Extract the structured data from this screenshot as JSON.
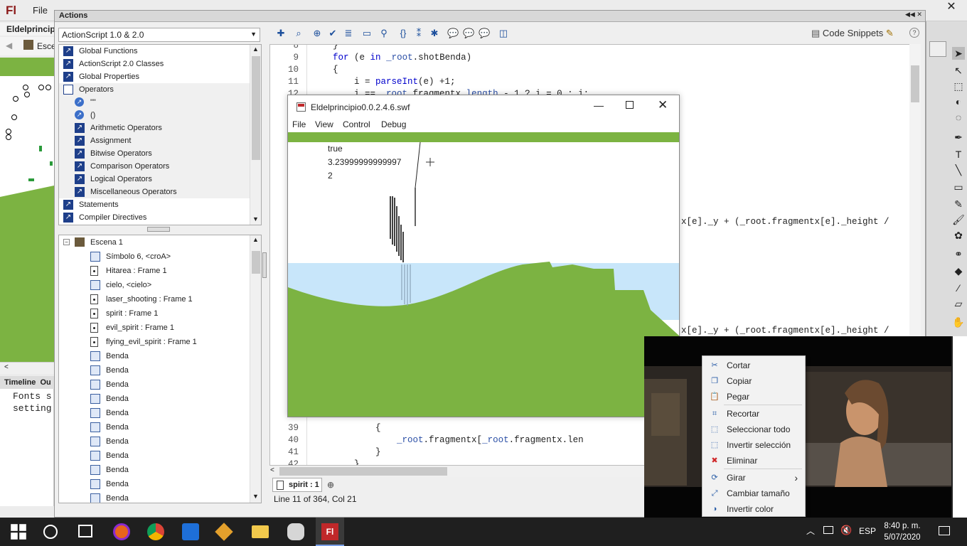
{
  "app": {
    "logo": "Fl",
    "menu_file": "File",
    "doc_tab": "Eldelprincipi",
    "breadcrumb": "Esce"
  },
  "actions": {
    "title": "Actions",
    "version": "ActionScript 1.0 & 2.0",
    "toolbox": [
      {
        "label": "Global Functions",
        "indent": 0
      },
      {
        "label": "ActionScript 2.0 Classes",
        "indent": 0
      },
      {
        "label": "Global Properties",
        "indent": 0
      },
      {
        "label": "Operators",
        "indent": 0,
        "open": true
      },
      {
        "label": "\"\"",
        "indent": 1,
        "bullet": true
      },
      {
        "label": "()",
        "indent": 1,
        "bullet": true
      },
      {
        "label": "Arithmetic Operators",
        "indent": 1
      },
      {
        "label": "Assignment",
        "indent": 1
      },
      {
        "label": "Bitwise Operators",
        "indent": 1
      },
      {
        "label": "Comparison Operators",
        "indent": 1
      },
      {
        "label": "Logical Operators",
        "indent": 1
      },
      {
        "label": "Miscellaneous Operators",
        "indent": 1
      },
      {
        "label": "Statements",
        "indent": 0
      },
      {
        "label": "Compiler Directives",
        "indent": 0
      }
    ],
    "scene": "Escena 1",
    "tree": [
      {
        "label": "Símbolo 6, <croA>",
        "kind": "sym"
      },
      {
        "label": "Hitarea : Frame 1",
        "kind": "frame"
      },
      {
        "label": "cielo, <cielo>",
        "kind": "sym"
      },
      {
        "label": "laser_shooting : Frame 1",
        "kind": "frame"
      },
      {
        "label": "spirit : Frame 1",
        "kind": "frame"
      },
      {
        "label": "evil_spirit : Frame 1",
        "kind": "frame"
      },
      {
        "label": "flying_evil_spirit : Frame 1",
        "kind": "frame"
      },
      {
        "label": "Benda",
        "kind": "sym"
      },
      {
        "label": "Benda",
        "kind": "sym"
      },
      {
        "label": "Benda",
        "kind": "sym"
      },
      {
        "label": "Benda",
        "kind": "sym"
      },
      {
        "label": "Benda",
        "kind": "sym"
      },
      {
        "label": "Benda",
        "kind": "sym"
      },
      {
        "label": "Benda",
        "kind": "sym"
      },
      {
        "label": "Benda",
        "kind": "sym"
      },
      {
        "label": "Benda",
        "kind": "sym"
      },
      {
        "label": "Benda",
        "kind": "sym"
      },
      {
        "label": "Benda",
        "kind": "sym"
      }
    ],
    "snippets": "Code Snippets",
    "script_tab": "spirit : 1",
    "status": "Line 11 of 364, Col 21"
  },
  "code": {
    "top": [
      {
        "n": "8",
        "t": "    }"
      },
      {
        "n": "9",
        "t": "    for (e in _root.shotBenda)"
      },
      {
        "n": "10",
        "t": "    {"
      },
      {
        "n": "11",
        "t": "        i = parseInt(e) +1;"
      },
      {
        "n": "12",
        "t": "        i == _root.fragmentx.length - 1 ? i = 0 : i;"
      }
    ],
    "frag_a": "x[e]._y + (_root.fragmentx[e]._height /",
    "frag_b": "x[e]._y + (_root.fragmentx[e]._height /",
    "bottom": [
      {
        "n": "39",
        "t": "            {"
      },
      {
        "n": "40",
        "t": "                _root.fragmentx[_root.fragmentx.len"
      },
      {
        "n": "41",
        "t": "            }"
      },
      {
        "n": "42",
        "t": "        }"
      }
    ]
  },
  "timeline": {
    "tab1": "Timeline",
    "tab2": "Ou",
    "output_text": "Fonts s\nsetting"
  },
  "swf": {
    "title": "Eldelprincipio0.0.2.4.6.swf",
    "menu": [
      "File",
      "View",
      "Control",
      "Debug"
    ],
    "trace": [
      "true",
      "3.23999999999997",
      "2"
    ]
  },
  "context_menu": [
    {
      "label": "Cortar",
      "icon": "scissors-icon"
    },
    {
      "label": "Copiar",
      "icon": "copy-icon"
    },
    {
      "label": "Pegar",
      "icon": "paste-icon"
    },
    {
      "label": "Recortar",
      "icon": "crop-icon"
    },
    {
      "label": "Seleccionar todo",
      "icon": "select-all-icon"
    },
    {
      "label": "Invertir selección",
      "icon": "invert-selection-icon"
    },
    {
      "label": "Eliminar",
      "icon": "delete-icon"
    },
    {
      "label": "Girar",
      "icon": "rotate-icon",
      "submenu": true
    },
    {
      "label": "Cambiar tamaño",
      "icon": "resize-icon"
    },
    {
      "label": "Invertir color",
      "icon": "invert-color-icon"
    }
  ],
  "taskbar": {
    "lang": "ESP",
    "time": "8:40 p. m.",
    "date": "5/07/2020"
  },
  "colors": {
    "grass": "#7cb342",
    "water": "#c8e6fa",
    "keyword": "#0000cc",
    "flash_red": "#8b1a1a"
  }
}
